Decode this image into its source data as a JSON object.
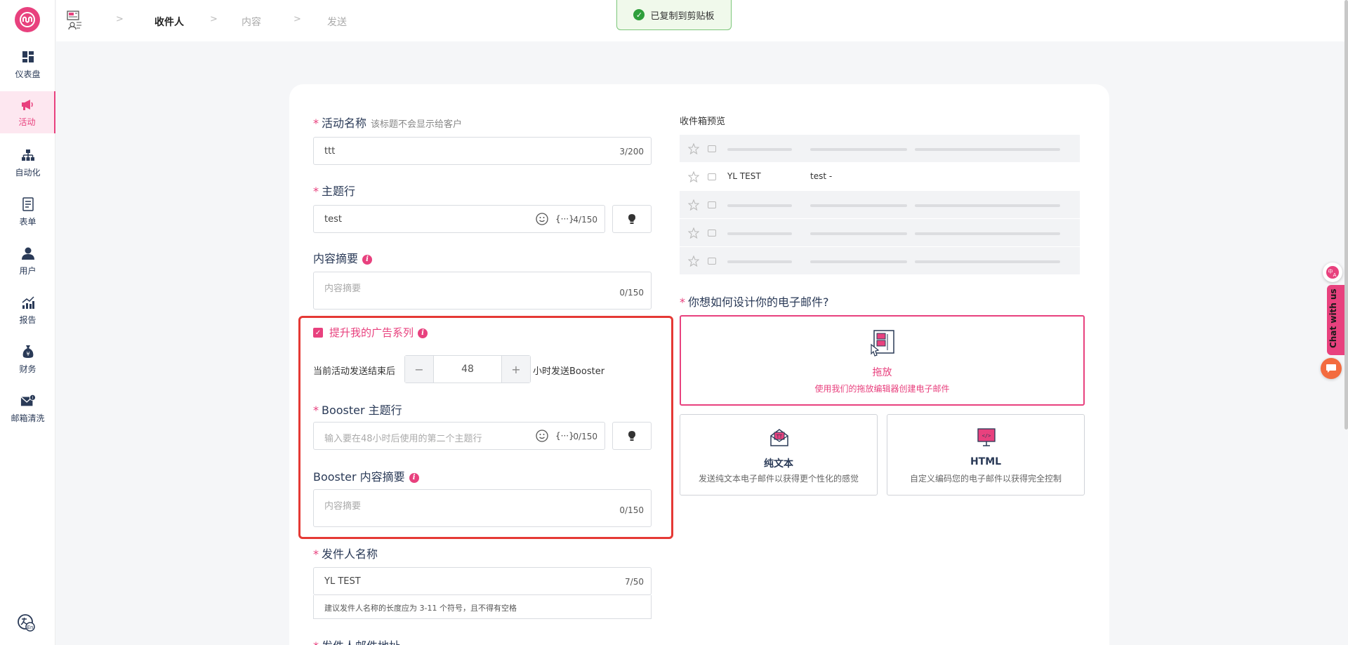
{
  "sidebar": {
    "items": [
      {
        "label": "仪表盘",
        "icon": "dashboard-icon"
      },
      {
        "label": "活动",
        "icon": "megaphone-icon",
        "active": true
      },
      {
        "label": "自动化",
        "icon": "automation-icon"
      },
      {
        "label": "表单",
        "icon": "form-icon"
      },
      {
        "label": "用户",
        "icon": "user-icon"
      },
      {
        "label": "报告",
        "icon": "report-icon"
      },
      {
        "label": "财务",
        "icon": "finance-icon"
      },
      {
        "label": "邮箱清洗",
        "icon": "email-clean-icon"
      }
    ]
  },
  "topbar": {
    "steps": [
      "收件人",
      "内容",
      "发送"
    ],
    "toast": "已复制到剪贴板"
  },
  "form": {
    "campaign_name": {
      "label": "活动名称",
      "hint": "该标题不会显示给客户",
      "value": "ttt",
      "count": "3/200"
    },
    "subject": {
      "label": "主题行",
      "value": "test",
      "var": "{···}",
      "count": "4/150"
    },
    "preheader": {
      "label": "内容摘要",
      "placeholder": "内容摘要",
      "count": "0/150"
    },
    "booster": {
      "checkbox_label": "提升我的广告系列",
      "delay_prefix": "当前活动发送结束后",
      "hours": "48",
      "delay_suffix": "小时发送Booster",
      "subject_label": "Booster 主题行",
      "subject_placeholder": "输入要在48小时后使用的第二个主题行",
      "subject_count": "0/150",
      "var": "{···}",
      "preheader_label": "Booster 内容摘要",
      "preheader_placeholder": "内容摘要",
      "preheader_count": "0/150"
    },
    "sender_name": {
      "label": "发件人名称",
      "value": "YL TEST",
      "count": "7/50",
      "helper": "建议发件人名称的长度应为 3-11 个符号，且不得有空格"
    },
    "sender_email": {
      "label": "发件人邮件地址"
    }
  },
  "preview": {
    "title": "收件箱预览",
    "sender": "YL TEST",
    "subject": "test -"
  },
  "design": {
    "question": "你想如何设计你的电子邮件?",
    "options": [
      {
        "title": "拖放",
        "desc": "使用我们的拖放编辑器创建电子邮件",
        "selected": true
      },
      {
        "title": "纯文本",
        "desc": "发送纯文本电子邮件以获得更个性化的感觉"
      },
      {
        "title": "HTML",
        "desc": "自定义编码您的电子邮件以获得完全控制"
      }
    ]
  },
  "widgets": {
    "chat": "Chat with us"
  },
  "colors": {
    "accent": "#e8417e",
    "highlight_border": "#e53935"
  }
}
